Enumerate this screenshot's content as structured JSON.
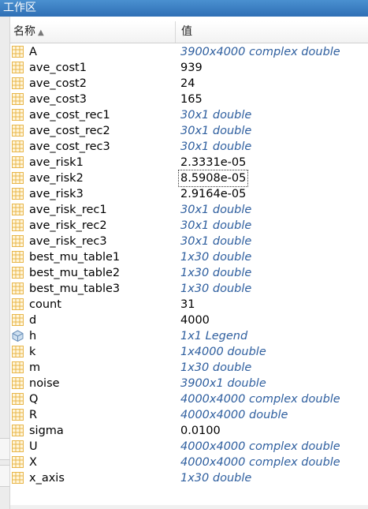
{
  "window": {
    "title": "工作区"
  },
  "columns": {
    "name": "名称",
    "value": "值"
  },
  "variables": [
    {
      "name": "A",
      "value": "3900x4000 complex double",
      "italic": true,
      "icon": "matrix-icon"
    },
    {
      "name": "ave_cost1",
      "value": "939",
      "italic": false,
      "icon": "matrix-icon"
    },
    {
      "name": "ave_cost2",
      "value": "24",
      "italic": false,
      "icon": "matrix-icon"
    },
    {
      "name": "ave_cost3",
      "value": "165",
      "italic": false,
      "icon": "matrix-icon"
    },
    {
      "name": "ave_cost_rec1",
      "value": "30x1 double",
      "italic": true,
      "icon": "matrix-icon"
    },
    {
      "name": "ave_cost_rec2",
      "value": "30x1 double",
      "italic": true,
      "icon": "matrix-icon"
    },
    {
      "name": "ave_cost_rec3",
      "value": "30x1 double",
      "italic": true,
      "icon": "matrix-icon"
    },
    {
      "name": "ave_risk1",
      "value": "2.3331e-05",
      "italic": false,
      "icon": "matrix-icon"
    },
    {
      "name": "ave_risk2",
      "value": "8.5908e-05",
      "italic": false,
      "icon": "matrix-icon",
      "selected": true
    },
    {
      "name": "ave_risk3",
      "value": "2.9164e-05",
      "italic": false,
      "icon": "matrix-icon"
    },
    {
      "name": "ave_risk_rec1",
      "value": "30x1 double",
      "italic": true,
      "icon": "matrix-icon"
    },
    {
      "name": "ave_risk_rec2",
      "value": "30x1 double",
      "italic": true,
      "icon": "matrix-icon"
    },
    {
      "name": "ave_risk_rec3",
      "value": "30x1 double",
      "italic": true,
      "icon": "matrix-icon"
    },
    {
      "name": "best_mu_table1",
      "value": "1x30 double",
      "italic": true,
      "icon": "matrix-icon"
    },
    {
      "name": "best_mu_table2",
      "value": "1x30 double",
      "italic": true,
      "icon": "matrix-icon"
    },
    {
      "name": "best_mu_table3",
      "value": "1x30 double",
      "italic": true,
      "icon": "matrix-icon"
    },
    {
      "name": "count",
      "value": "31",
      "italic": false,
      "icon": "matrix-icon"
    },
    {
      "name": "d",
      "value": "4000",
      "italic": false,
      "icon": "matrix-icon"
    },
    {
      "name": "h",
      "value": "1x1 Legend",
      "italic": true,
      "icon": "object-cube-icon"
    },
    {
      "name": "k",
      "value": "1x4000 double",
      "italic": true,
      "icon": "matrix-icon"
    },
    {
      "name": "m",
      "value": "1x30 double",
      "italic": true,
      "icon": "matrix-icon"
    },
    {
      "name": "noise",
      "value": "3900x1 double",
      "italic": true,
      "icon": "matrix-icon"
    },
    {
      "name": "Q",
      "value": "4000x4000 complex double",
      "italic": true,
      "icon": "matrix-icon"
    },
    {
      "name": "R",
      "value": "4000x4000 double",
      "italic": true,
      "icon": "matrix-icon"
    },
    {
      "name": "sigma",
      "value": "0.0100",
      "italic": false,
      "icon": "matrix-icon"
    },
    {
      "name": "U",
      "value": "4000x4000 complex double",
      "italic": true,
      "icon": "matrix-icon"
    },
    {
      "name": "X",
      "value": "4000x4000 complex double",
      "italic": true,
      "icon": "matrix-icon"
    },
    {
      "name": "x_axis",
      "value": "1x30 double",
      "italic": true,
      "icon": "matrix-icon"
    }
  ],
  "colors": {
    "titlebar": "#3a7fc4",
    "italic_value": "#2f5f9f",
    "matrix_icon": "#e8b64a",
    "cube_icon": "#6a8fb8"
  }
}
